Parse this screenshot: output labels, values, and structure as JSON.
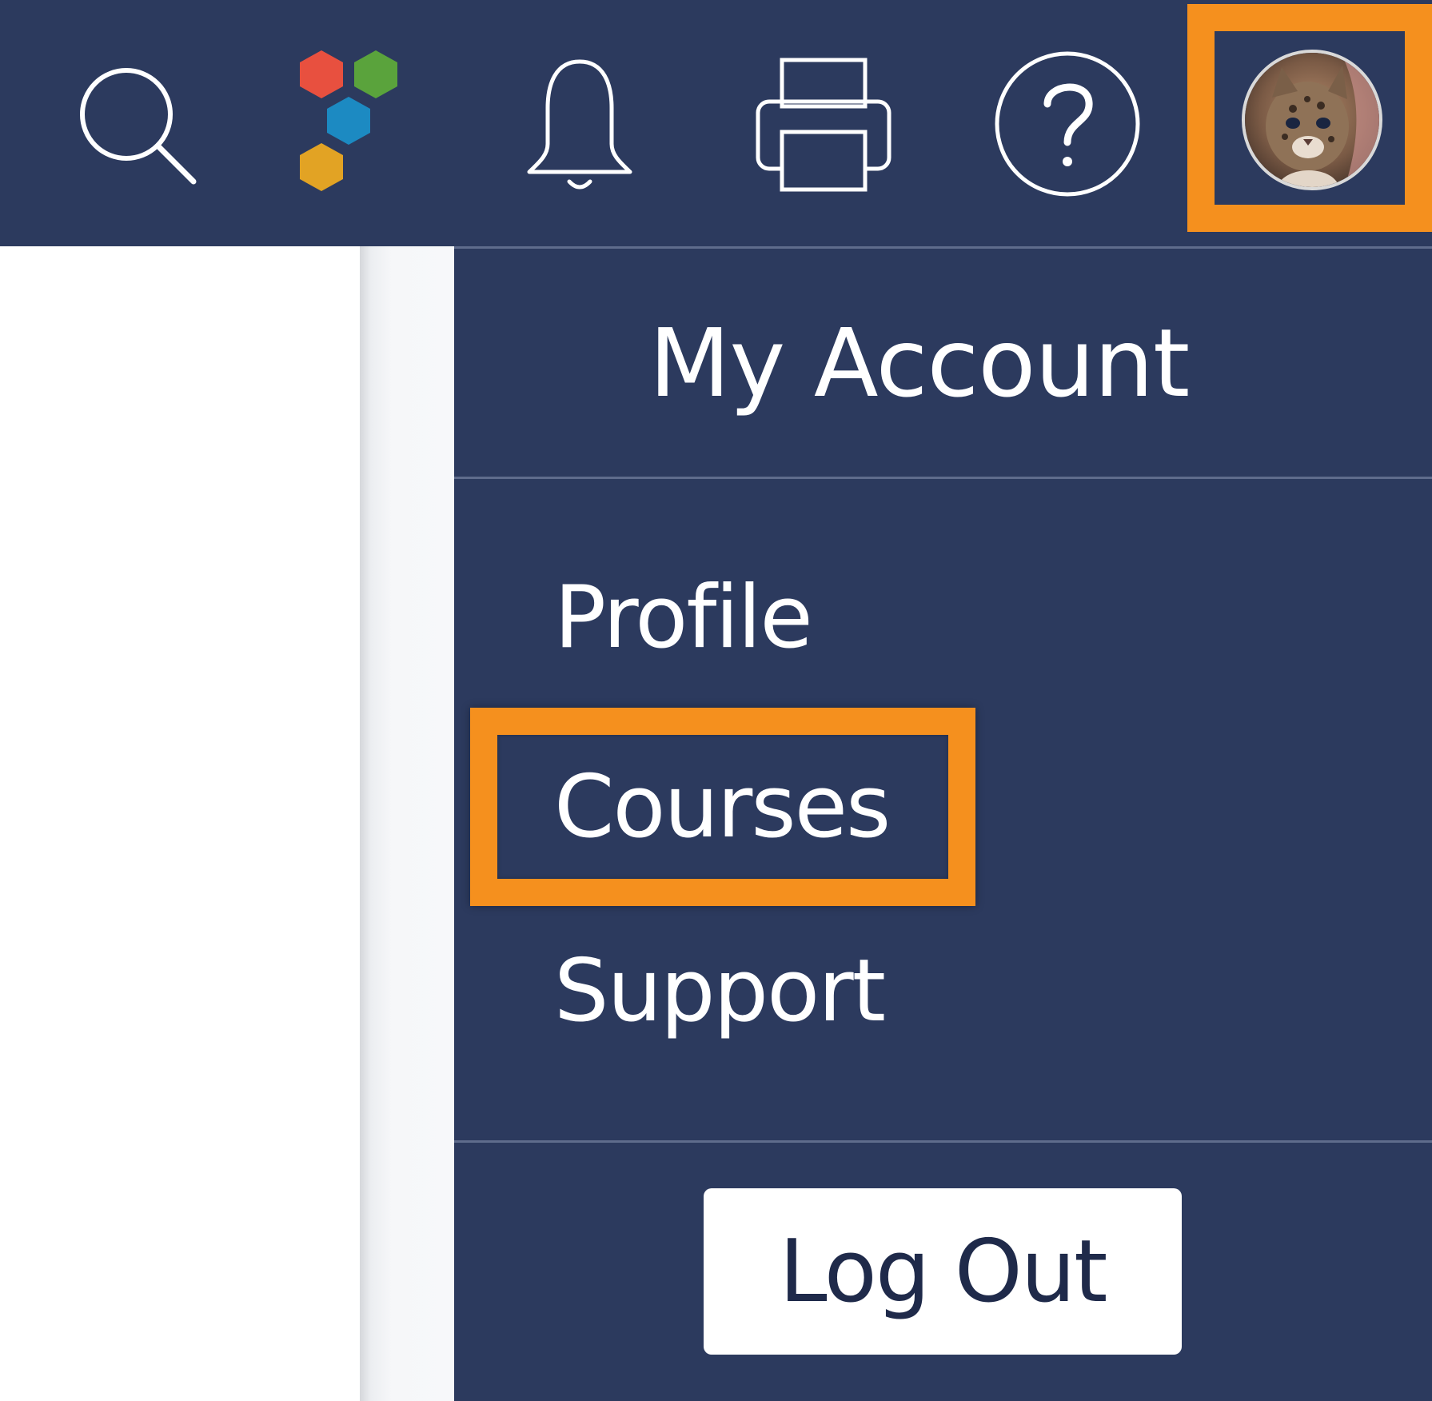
{
  "header": {
    "icons": {
      "search": "search-icon",
      "apps": "apps-hexagon-icon",
      "notifications": "bell-icon",
      "print": "printer-icon",
      "help": "help-icon",
      "account": "avatar"
    }
  },
  "account_menu": {
    "title": "My Account",
    "items": [
      {
        "label": "Profile"
      },
      {
        "label": "Courses",
        "highlighted": true
      },
      {
        "label": "Support"
      }
    ],
    "logout_label": "Log Out"
  },
  "colors": {
    "nav_background": "#2c3a5e",
    "highlight": "#f5901e",
    "text": "#ffffff",
    "button_text": "#1f2a4a",
    "hex_red": "#e8503f",
    "hex_green": "#5aa33c",
    "hex_blue": "#1c8ac2",
    "hex_yellow": "#e2a324"
  }
}
